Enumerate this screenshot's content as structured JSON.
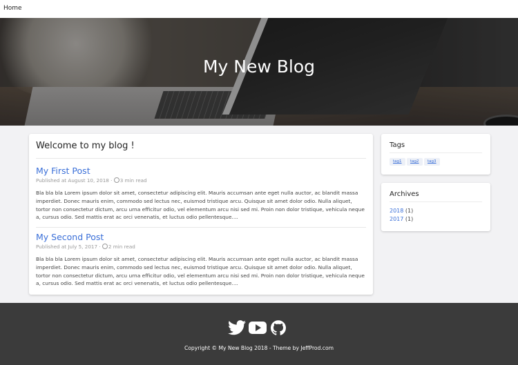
{
  "nav": {
    "home": "Home"
  },
  "hero": {
    "title": "My New Blog"
  },
  "main": {
    "heading": "Welcome to my blog !",
    "posts": [
      {
        "title": "My First Post",
        "published": "Published at August 10, 2018 · ",
        "read_time": "3 min read",
        "excerpt": "Bla bla bla Lorem ipsum dolor sit amet, consectetur adipiscing elit. Mauris accumsan ante eget nulla auctor, ac blandit massa imperdiet. Donec mauris enim, commodo sed lectus nec, euismod tristique arcu. Quisque sit amet dolor odio. Nulla aliquet, tortor non consectetur dictum, arcu urna efficitur odio, vel elementum arcu nisi sed mi. Proin non dolor tristique, vehicula neque a, cursus odio. Sed mattis erat ac orci venenatis, et luctus odio pellentesque...."
      },
      {
        "title": "My Second Post",
        "published": "Published at July 5, 2017 · ",
        "read_time": "2 min read",
        "excerpt": "Bla bla bla Lorem ipsum dolor sit amet, consectetur adipiscing elit. Mauris accumsan ante eget nulla auctor, ac blandit massa imperdiet. Donec mauris enim, commodo sed lectus nec, euismod tristique arcu. Quisque sit amet dolor odio. Nulla aliquet, tortor non consectetur dictum, arcu urna efficitur odio, vel elementum arcu nisi sed mi. Proin non dolor tristique, vehicula neque a, cursus odio. Sed mattis erat ac orci venenatis, et luctus odio pellentesque...."
      }
    ]
  },
  "sidebar": {
    "tags": {
      "heading": "Tags",
      "items": [
        "tag1",
        "tag2",
        "tag3"
      ]
    },
    "archives": {
      "heading": "Archives",
      "items": [
        {
          "year": "2018",
          "count": "(1)"
        },
        {
          "year": "2017",
          "count": "(1)"
        }
      ]
    }
  },
  "footer": {
    "icons": [
      "twitter-icon",
      "youtube-icon",
      "github-icon"
    ],
    "copyright": "Copyright © My New Blog 2018 - Theme by JeffProd.com"
  },
  "colors": {
    "link": "#3a6fd8",
    "footer_bg": "#3b3b3b",
    "page_bg": "#f2f2f4"
  }
}
